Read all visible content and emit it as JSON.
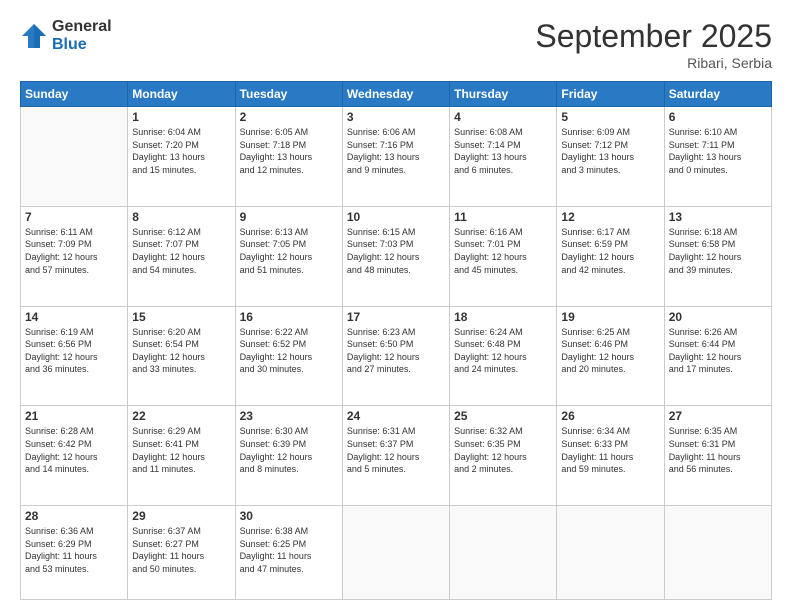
{
  "logo": {
    "general": "General",
    "blue": "Blue"
  },
  "title": "September 2025",
  "subtitle": "Ribari, Serbia",
  "days_header": [
    "Sunday",
    "Monday",
    "Tuesday",
    "Wednesday",
    "Thursday",
    "Friday",
    "Saturday"
  ],
  "weeks": [
    [
      {
        "day": "",
        "info": ""
      },
      {
        "day": "1",
        "info": "Sunrise: 6:04 AM\nSunset: 7:20 PM\nDaylight: 13 hours\nand 15 minutes."
      },
      {
        "day": "2",
        "info": "Sunrise: 6:05 AM\nSunset: 7:18 PM\nDaylight: 13 hours\nand 12 minutes."
      },
      {
        "day": "3",
        "info": "Sunrise: 6:06 AM\nSunset: 7:16 PM\nDaylight: 13 hours\nand 9 minutes."
      },
      {
        "day": "4",
        "info": "Sunrise: 6:08 AM\nSunset: 7:14 PM\nDaylight: 13 hours\nand 6 minutes."
      },
      {
        "day": "5",
        "info": "Sunrise: 6:09 AM\nSunset: 7:12 PM\nDaylight: 13 hours\nand 3 minutes."
      },
      {
        "day": "6",
        "info": "Sunrise: 6:10 AM\nSunset: 7:11 PM\nDaylight: 13 hours\nand 0 minutes."
      }
    ],
    [
      {
        "day": "7",
        "info": "Sunrise: 6:11 AM\nSunset: 7:09 PM\nDaylight: 12 hours\nand 57 minutes."
      },
      {
        "day": "8",
        "info": "Sunrise: 6:12 AM\nSunset: 7:07 PM\nDaylight: 12 hours\nand 54 minutes."
      },
      {
        "day": "9",
        "info": "Sunrise: 6:13 AM\nSunset: 7:05 PM\nDaylight: 12 hours\nand 51 minutes."
      },
      {
        "day": "10",
        "info": "Sunrise: 6:15 AM\nSunset: 7:03 PM\nDaylight: 12 hours\nand 48 minutes."
      },
      {
        "day": "11",
        "info": "Sunrise: 6:16 AM\nSunset: 7:01 PM\nDaylight: 12 hours\nand 45 minutes."
      },
      {
        "day": "12",
        "info": "Sunrise: 6:17 AM\nSunset: 6:59 PM\nDaylight: 12 hours\nand 42 minutes."
      },
      {
        "day": "13",
        "info": "Sunrise: 6:18 AM\nSunset: 6:58 PM\nDaylight: 12 hours\nand 39 minutes."
      }
    ],
    [
      {
        "day": "14",
        "info": "Sunrise: 6:19 AM\nSunset: 6:56 PM\nDaylight: 12 hours\nand 36 minutes."
      },
      {
        "day": "15",
        "info": "Sunrise: 6:20 AM\nSunset: 6:54 PM\nDaylight: 12 hours\nand 33 minutes."
      },
      {
        "day": "16",
        "info": "Sunrise: 6:22 AM\nSunset: 6:52 PM\nDaylight: 12 hours\nand 30 minutes."
      },
      {
        "day": "17",
        "info": "Sunrise: 6:23 AM\nSunset: 6:50 PM\nDaylight: 12 hours\nand 27 minutes."
      },
      {
        "day": "18",
        "info": "Sunrise: 6:24 AM\nSunset: 6:48 PM\nDaylight: 12 hours\nand 24 minutes."
      },
      {
        "day": "19",
        "info": "Sunrise: 6:25 AM\nSunset: 6:46 PM\nDaylight: 12 hours\nand 20 minutes."
      },
      {
        "day": "20",
        "info": "Sunrise: 6:26 AM\nSunset: 6:44 PM\nDaylight: 12 hours\nand 17 minutes."
      }
    ],
    [
      {
        "day": "21",
        "info": "Sunrise: 6:28 AM\nSunset: 6:42 PM\nDaylight: 12 hours\nand 14 minutes."
      },
      {
        "day": "22",
        "info": "Sunrise: 6:29 AM\nSunset: 6:41 PM\nDaylight: 12 hours\nand 11 minutes."
      },
      {
        "day": "23",
        "info": "Sunrise: 6:30 AM\nSunset: 6:39 PM\nDaylight: 12 hours\nand 8 minutes."
      },
      {
        "day": "24",
        "info": "Sunrise: 6:31 AM\nSunset: 6:37 PM\nDaylight: 12 hours\nand 5 minutes."
      },
      {
        "day": "25",
        "info": "Sunrise: 6:32 AM\nSunset: 6:35 PM\nDaylight: 12 hours\nand 2 minutes."
      },
      {
        "day": "26",
        "info": "Sunrise: 6:34 AM\nSunset: 6:33 PM\nDaylight: 11 hours\nand 59 minutes."
      },
      {
        "day": "27",
        "info": "Sunrise: 6:35 AM\nSunset: 6:31 PM\nDaylight: 11 hours\nand 56 minutes."
      }
    ],
    [
      {
        "day": "28",
        "info": "Sunrise: 6:36 AM\nSunset: 6:29 PM\nDaylight: 11 hours\nand 53 minutes."
      },
      {
        "day": "29",
        "info": "Sunrise: 6:37 AM\nSunset: 6:27 PM\nDaylight: 11 hours\nand 50 minutes."
      },
      {
        "day": "30",
        "info": "Sunrise: 6:38 AM\nSunset: 6:25 PM\nDaylight: 11 hours\nand 47 minutes."
      },
      {
        "day": "",
        "info": ""
      },
      {
        "day": "",
        "info": ""
      },
      {
        "day": "",
        "info": ""
      },
      {
        "day": "",
        "info": ""
      }
    ]
  ]
}
